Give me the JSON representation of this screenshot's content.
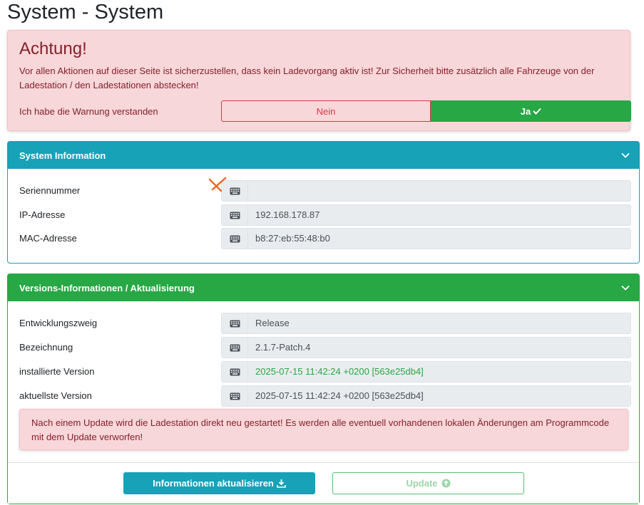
{
  "page": {
    "title": "System - System"
  },
  "warning": {
    "title": "Achtung!",
    "text": "Vor allen Aktionen auf dieser Seite ist sicherzustellen, dass kein Ladevorgang aktiv ist! Zur Sicherheit bitte zusätzlich alle Fahrzeuge von der Ladestation / den Ladestationen abstecken!",
    "ack_label": "Ich habe die Warnung verstanden",
    "no_label": "Nein",
    "yes_label": "Ja",
    "selected": "Ja"
  },
  "system_info": {
    "header": "System Information",
    "rows": [
      {
        "label": "Seriennummer",
        "value": ""
      },
      {
        "label": "IP-Adresse",
        "value": "192.168.178.87"
      },
      {
        "label": "MAC-Adresse",
        "value": "b8:27:eb:55:48:b0"
      }
    ]
  },
  "version_info": {
    "header": "Versions-Informationen / Aktualisierung",
    "rows": [
      {
        "label": "Entwicklungszweig",
        "value": "Release"
      },
      {
        "label": "Bezeichnung",
        "value": "2.1.7-Patch.4"
      },
      {
        "label": "installierte Version",
        "value": "2025-07-15 11:42:24 +0200 [563e25db4]"
      },
      {
        "label": "aktuellste Version",
        "value": "2025-07-15 11:42:24 +0200 [563e25db4]"
      }
    ],
    "alert": "Nach einem Update wird die Ladestation direkt neu gestartet! Es werden alle eventuell vorhandenen lokalen Änderungen am Programmcode mit dem Update verworfen!",
    "refresh_label": "Informationen aktualisieren",
    "update_label": "Update"
  },
  "colors": {
    "info": "#17a2b8",
    "success": "#28a745",
    "danger": "#dc3545",
    "alert_bg": "#f8d7da",
    "alert_text": "#842029"
  },
  "icons": {
    "check": "check-icon",
    "chevron": "chevron-down-icon",
    "keyboard": "keyboard-icon",
    "download": "download-icon",
    "arrow_up": "arrow-circle-up-icon"
  }
}
